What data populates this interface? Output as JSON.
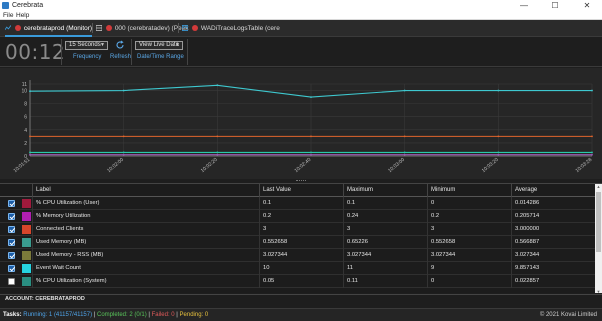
{
  "window": {
    "title": "Cerebrata",
    "minimize": "—",
    "maximize": "☐",
    "close": "✕"
  },
  "menu": {
    "file": "File",
    "help": "Help"
  },
  "tabs": [
    {
      "label": "cerebrataprod (Monitor)",
      "icon": "monitor-icon"
    },
    {
      "label": "000 (cerebratadev) (Peek",
      "icon": "queue-icon"
    },
    {
      "label": "WADiTraceLogsTable (cere",
      "icon": "table-icon"
    }
  ],
  "toolbar": {
    "timer": "00:12",
    "frequency_value": "15 Seconds",
    "frequency_label": "Frequency",
    "refresh_label": "Refresh",
    "view_value": "View Live Data",
    "view_label": "Date/Time Range"
  },
  "chart_data": {
    "type": "line",
    "x": [
      "10:01:51",
      "10:02:00",
      "10:02:20",
      "10:02:40",
      "10:03:00",
      "10:03:20",
      "10:03:28"
    ],
    "ylim": [
      0,
      11
    ],
    "y_ticks": [
      "11",
      "10",
      "8",
      "6",
      "4",
      "2",
      "0"
    ],
    "grid": true,
    "series": [
      {
        "color": "#3ec8cf",
        "values": [
          9.9,
          10,
          10.8,
          9,
          10,
          10,
          10
        ]
      },
      {
        "color": "#e0642c",
        "values": [
          3,
          3,
          3,
          3,
          3,
          3,
          3
        ]
      },
      {
        "color": "#9b59b6",
        "values": [
          0.2,
          0.2,
          0.2,
          0.2,
          0.2,
          0.2,
          0.2
        ]
      },
      {
        "color": "#29c9a9",
        "values": [
          0.55,
          0.55,
          0.55,
          0.55,
          0.55,
          0.55,
          0.55
        ]
      }
    ]
  },
  "grid": {
    "columns": [
      "Label",
      "Last Value",
      "Maximum",
      "Minimum",
      "Average"
    ],
    "rows": [
      {
        "checked": true,
        "color": "#a01a3c",
        "label": "% CPU Utilization (User)",
        "last": "0.1",
        "max": "0.1",
        "min": "0",
        "avg": "0.014286"
      },
      {
        "checked": true,
        "color": "#b11fb1",
        "label": "% Memory Utilization",
        "last": "0.2",
        "max": "0.24",
        "min": "0.2",
        "avg": "0.205714"
      },
      {
        "checked": true,
        "color": "#d6452b",
        "label": "Connected Clients",
        "last": "3",
        "max": "3",
        "min": "3",
        "avg": "3.000000"
      },
      {
        "checked": true,
        "color": "#3a9c8f",
        "label": "Used Memory (MB)",
        "last": "0.552658",
        "max": "0.65226",
        "min": "0.552658",
        "avg": "0.566887"
      },
      {
        "checked": true,
        "color": "#7b7a3a",
        "label": "Used Memory - RSS (MB)",
        "last": "3.027344",
        "max": "3.027344",
        "min": "3.027344",
        "avg": "3.027344"
      },
      {
        "checked": true,
        "color": "#26d3e0",
        "label": "Event Wait Count",
        "last": "10",
        "max": "11",
        "min": "9",
        "avg": "9.857143"
      },
      {
        "checked": false,
        "color": "#2a8f82",
        "label": "% CPU Utilization (System)",
        "last": "0.05",
        "max": "0.11",
        "min": "0",
        "avg": "0.022857"
      }
    ]
  },
  "account": "ACCOUNT: CEREBRATAPROD",
  "status": {
    "label": "Tasks:",
    "running": "Running: 1 (41157/41157)",
    "completed": "Completed: 2 (0/1)",
    "failed": "Failed: 0",
    "pending": "Pending: 0",
    "copyright": "© 2021 Kovai Limited"
  }
}
